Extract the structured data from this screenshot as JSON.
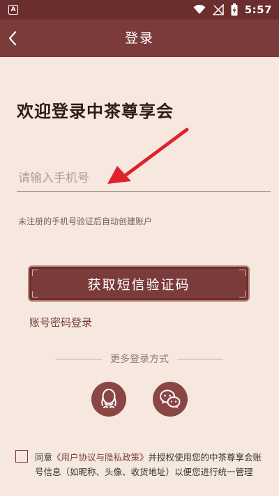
{
  "status_bar": {
    "time": "5:57",
    "left_icon": "A",
    "icons": [
      "wifi-icon",
      "signal-off-icon",
      "battery-charging-icon"
    ]
  },
  "header": {
    "title": "登录",
    "back_icon": "chevron-left-icon"
  },
  "welcome": "欢迎登录中茶尊享会",
  "phone": {
    "placeholder": "请输入手机号",
    "value": ""
  },
  "hint": "未注册的手机号验证后自动创建账户",
  "sms_button_label": "获取短信验证码",
  "password_login_label": "账号密码登录",
  "more_login_label": "更多登录方式",
  "social": [
    {
      "name": "qq",
      "icon": "qq-penguin-icon"
    },
    {
      "name": "wechat",
      "icon": "wechat-icon"
    }
  ],
  "agreement": {
    "checked": false,
    "prefix": "同意",
    "link": "《用户协议与隐私政策》",
    "suffix": "并授权使用您的中茶尊享会账号信息（如昵称、头像、收货地址）以便您进行统一管理"
  },
  "colors": {
    "brand": "#7a3b3a",
    "background": "#f6e8df",
    "annotation_arrow": "#e0212b"
  }
}
